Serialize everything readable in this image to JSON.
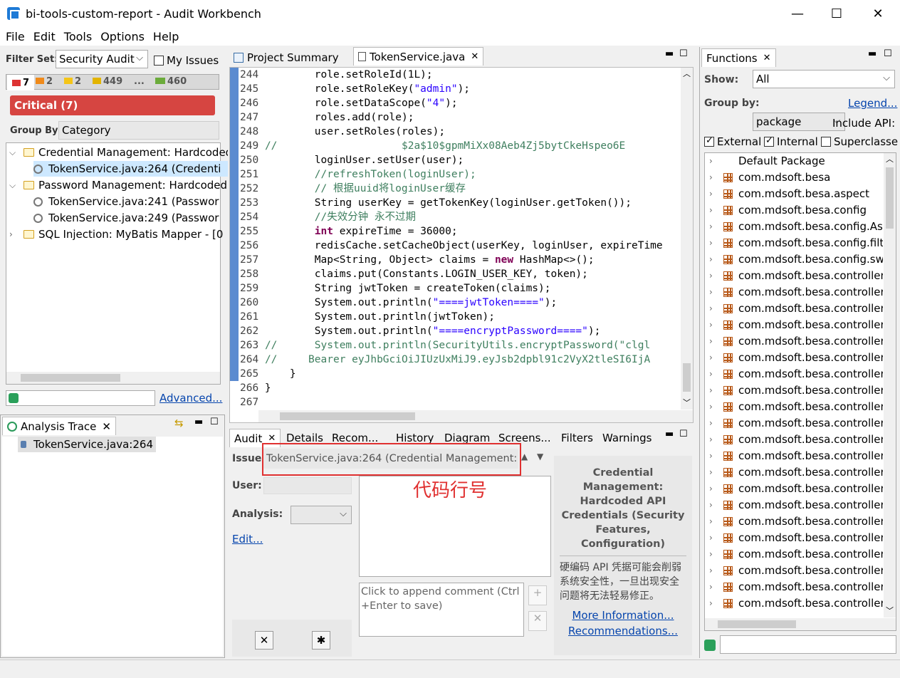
{
  "window": {
    "title": "bi-tools-custom-report - Audit Workbench",
    "minimize": "—",
    "maximize": "☐",
    "close": "✕"
  },
  "menu": [
    "File",
    "Edit",
    "Tools",
    "Options",
    "Help"
  ],
  "filter": {
    "label": "Filter Set:",
    "value": "Security Audit",
    "my_issues": "My Issues",
    "counts": [
      "7",
      "2",
      "2",
      "449",
      "...",
      "460"
    ],
    "severity_bar": "Critical (7)",
    "group_by_label": "Group By:",
    "group_by_value": "Category",
    "advanced": "Advanced...",
    "tree": [
      {
        "label": "Credential Management: Hardcoded",
        "type": "folder",
        "expanded": true
      },
      {
        "label": "TokenService.java:264 (Credenti",
        "type": "issue",
        "selected": true
      },
      {
        "label": "Password Management: Hardcoded",
        "type": "folder",
        "expanded": true
      },
      {
        "label": "TokenService.java:241 (Passwor",
        "type": "issue"
      },
      {
        "label": "TokenService.java:249 (Passwor",
        "type": "issue"
      },
      {
        "label": "SQL Injection: MyBatis Mapper - [0",
        "type": "folder",
        "expanded": false
      }
    ]
  },
  "trace": {
    "tab": "Analysis Trace",
    "item": "TokenService.java:264"
  },
  "editor": {
    "tabs": [
      "Project Summary",
      "TokenService.java"
    ],
    "lines": [
      {
        "n": "244",
        "html": "        role.setRoleId(1L);"
      },
      {
        "n": "245",
        "html": "        role.setRoleKey(<span class=\"str\">\"admin\"</span>);"
      },
      {
        "n": "246",
        "html": "        role.setDataScope(<span class=\"str\">\"4\"</span>);"
      },
      {
        "n": "247",
        "html": "        roles.add(role);"
      },
      {
        "n": "248",
        "html": "        user.setRoles(roles);"
      },
      {
        "n": "249",
        "html": "<span class=\"cm\">//                    $2a$10$gpmMiXx08Aeb4Zj5bytCkeHspeo6E</span>"
      },
      {
        "n": "250",
        "html": "        loginUser.setUser(user);"
      },
      {
        "n": "251",
        "html": "        <span class=\"cm\">//refreshToken(loginUser);</span>"
      },
      {
        "n": "252",
        "html": "        <span class=\"cm\">// 根据uuid将loginUser缓存</span>"
      },
      {
        "n": "253",
        "html": "        String userKey = getTokenKey(loginUser.getToken());"
      },
      {
        "n": "254",
        "html": "        <span class=\"cm\">//失效分钟 永不过期</span>"
      },
      {
        "n": "255",
        "html": "        <span class=\"kw\">int</span> expireTime = 36000;"
      },
      {
        "n": "256",
        "html": "        redisCache.setCacheObject(userKey, loginUser, expireTime"
      },
      {
        "n": "257",
        "html": "        Map&lt;String, Object&gt; claims = <span class=\"kw\">new</span> HashMap&lt;&gt;();"
      },
      {
        "n": "258",
        "html": "        claims.put(Constants.LOGIN_USER_KEY, token);"
      },
      {
        "n": "259",
        "html": "        String jwtToken = createToken(claims);"
      },
      {
        "n": "260",
        "html": "        System.out.println(<span class=\"str\">\"====jwtToken====\"</span>);"
      },
      {
        "n": "261",
        "html": "        System.out.println(jwtToken);"
      },
      {
        "n": "262",
        "html": "        System.out.println(<span class=\"str\">\"====encryptPassword====\"</span>);"
      },
      {
        "n": "263",
        "html": "<span class=\"cm\">//      System.out.println(SecurityUtils.encryptPassword(\"clgl</span>"
      },
      {
        "n": "264",
        "html": "<span class=\"cm\">//     Bearer eyJhbGciOiJIUzUxMiJ9.eyJsb2dpbl91c2VyX2tleSI6IjA</span>"
      },
      {
        "n": "265",
        "html": "    }"
      },
      {
        "n": "266",
        "html": "}"
      },
      {
        "n": "267",
        "html": ""
      }
    ]
  },
  "audit": {
    "tabs": [
      "Audit",
      "Details",
      "Recom...",
      "History",
      "Diagram",
      "Screens...",
      "Filters",
      "Warnings"
    ],
    "issue_label": "Issue:",
    "issue_value": "TokenService.java:264 (Credential Management:",
    "annotation": "代码行号",
    "user_label": "User:",
    "analysis_label": "Analysis:",
    "edit": "Edit...",
    "comment_placeholder": "Click to append comment (Ctrl +Enter to save)",
    "category_title": "Credential Management: Hardcoded API Credentials (Security Features, Configuration)",
    "description": "硬编码 API 凭据可能会削弱系统安全性，一旦出现安全问题将无法轻易修正。",
    "more_info": "More Information...",
    "recommendations": "Recommendations..."
  },
  "functions": {
    "tab": "Functions",
    "show_label": "Show:",
    "show_value": "All",
    "group_label": "Group by:",
    "group_value": "package",
    "legend": "Legend...",
    "include_api": "Include API:",
    "external": "External",
    "internal": "Internal",
    "superclass": "Superclasse",
    "packages": [
      "Default Package",
      "com.mdsoft.besa",
      "com.mdsoft.besa.aspect",
      "com.mdsoft.besa.config",
      "com.mdsoft.besa.config.Asy",
      "com.mdsoft.besa.config.filte",
      "com.mdsoft.besa.config.swa",
      "com.mdsoft.besa.controller",
      "com.mdsoft.besa.controller",
      "com.mdsoft.besa.controller",
      "com.mdsoft.besa.controller",
      "com.mdsoft.besa.controller",
      "com.mdsoft.besa.controller",
      "com.mdsoft.besa.controller",
      "com.mdsoft.besa.controller",
      "com.mdsoft.besa.controller",
      "com.mdsoft.besa.controller",
      "com.mdsoft.besa.controller",
      "com.mdsoft.besa.controller",
      "com.mdsoft.besa.controller",
      "com.mdsoft.besa.controller",
      "com.mdsoft.besa.controller",
      "com.mdsoft.besa.controller",
      "com.mdsoft.besa.controller",
      "com.mdsoft.besa.controller",
      "com.mdsoft.besa.controller",
      "com.mdsoft.besa.controller",
      "com.mdsoft.besa.controller"
    ]
  }
}
